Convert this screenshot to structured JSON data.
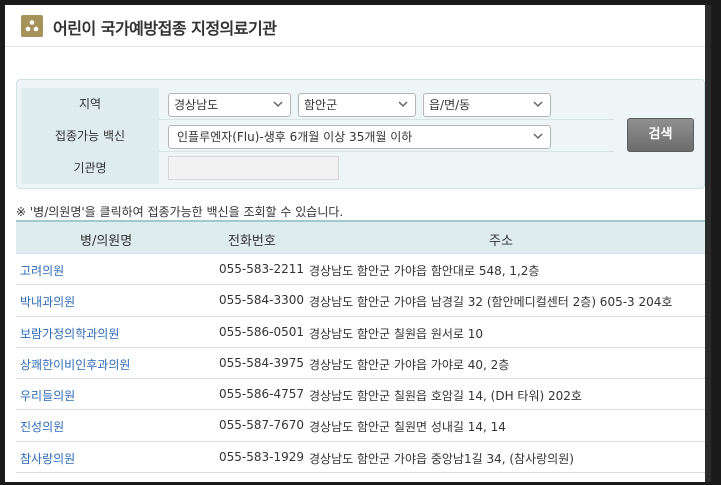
{
  "header": {
    "title": "어린이 국가예방접종 지정의료기관"
  },
  "search": {
    "region_label": "지역",
    "region_values": [
      "경상남도",
      "함안군",
      "읍/면/동"
    ],
    "vaccine_label": "접종가능 백신",
    "vaccine_value": "인플루엔자(Flu)-생후 6개월 이상 35개월 이하",
    "org_label": "기관명",
    "org_value": "",
    "search_button": "검색"
  },
  "notice": "※ '병/의원명'을 클릭하여 접종가능한 백신을 조회할 수 있습니다.",
  "table": {
    "headers": [
      "병/의원명",
      "전화번호",
      "주소"
    ],
    "rows": [
      [
        "고려의원",
        "055-583-2211",
        "경상남도 함안군 가야읍 함안대로 548, 1,2층"
      ],
      [
        "박내과의원",
        "055-584-3300",
        "경상남도 함안군 가야읍 남경길 32 (함안메디컬센터 2층) 605-3 204호"
      ],
      [
        "보람가정의학과의원",
        "055-586-0501",
        "경상남도 함안군 칠원읍 원서로 10"
      ],
      [
        "상쾌한이비인후과의원",
        "055-584-3975",
        "경상남도 함안군 가야읍 가야로 40, 2층"
      ],
      [
        "우리들의원",
        "055-586-4757",
        "경상남도 함안군 칠원읍 호암길 14, (DH 타워) 202호"
      ],
      [
        "진성의원",
        "055-587-7670",
        "경상남도 함안군 칠원면 성내길 14, 14"
      ],
      [
        "참사랑의원",
        "055-583-1929",
        "경상남도 함안군 가야읍 중앙남1길 34, (참사랑의원)"
      ]
    ]
  },
  "colors": {
    "accent": "#a6925a",
    "link": "#2d6bb8",
    "panel": "#eef5f6",
    "label_bg": "#dfecee"
  }
}
